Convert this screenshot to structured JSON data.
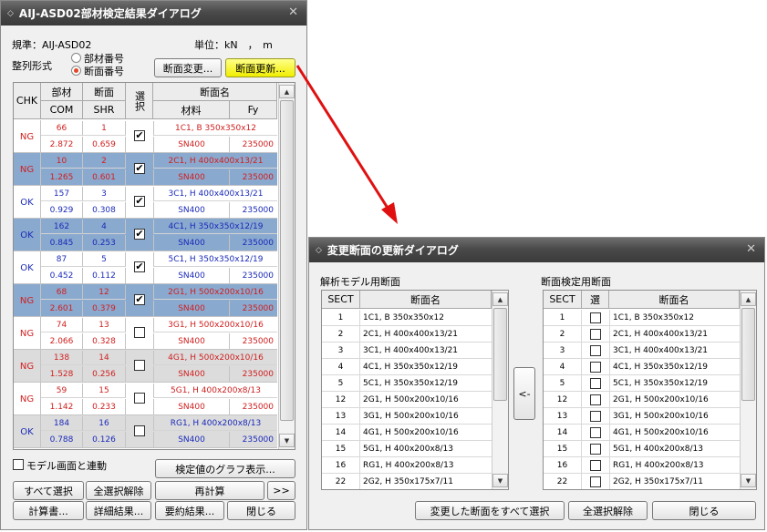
{
  "left_dialog": {
    "title": "AIJ-ASD02部材検定結果ダイアログ",
    "standard": "規準：AIJ-ASD02",
    "unit": "単位：kN　，　m",
    "sort_label": "整列形式",
    "sort_options": [
      "部材番号",
      "断面番号"
    ],
    "btn_section_change": "断面変更...",
    "btn_section_update": "断面更新...",
    "headers": {
      "chk": "CHK",
      "member": "部材",
      "section": "断面",
      "select": "選択",
      "section_name": "断面名",
      "com": "COM",
      "shr": "SHR",
      "material": "材料",
      "fy": "Fy"
    },
    "rows": [
      {
        "chk": "NG",
        "mem": "66",
        "sec": "1",
        "com": "2.872",
        "shr": "0.659",
        "name": "1C1, B 350x350x12",
        "mat": "SN400",
        "fy": "235000",
        "selected": true
      },
      {
        "chk": "NG",
        "mem": "10",
        "sec": "2",
        "com": "1.265",
        "shr": "0.601",
        "name": "2C1, H 400x400x13/21",
        "mat": "SN400",
        "fy": "235000",
        "selected": true
      },
      {
        "chk": "OK",
        "mem": "157",
        "sec": "3",
        "com": "0.929",
        "shr": "0.308",
        "name": "3C1, H 400x400x13/21",
        "mat": "SN400",
        "fy": "235000",
        "selected": true
      },
      {
        "chk": "OK",
        "mem": "162",
        "sec": "4",
        "com": "0.845",
        "shr": "0.253",
        "name": "4C1, H 350x350x12/19",
        "mat": "SN400",
        "fy": "235000",
        "selected": true
      },
      {
        "chk": "OK",
        "mem": "87",
        "sec": "5",
        "com": "0.452",
        "shr": "0.112",
        "name": "5C1, H 350x350x12/19",
        "mat": "SN400",
        "fy": "235000",
        "selected": true
      },
      {
        "chk": "NG",
        "mem": "68",
        "sec": "12",
        "com": "2.601",
        "shr": "0.379",
        "name": "2G1, H 500x200x10/16",
        "mat": "SN400",
        "fy": "235000",
        "selected": true
      },
      {
        "chk": "NG",
        "mem": "74",
        "sec": "13",
        "com": "2.066",
        "shr": "0.328",
        "name": "3G1, H 500x200x10/16",
        "mat": "SN400",
        "fy": "235000",
        "selected": false
      },
      {
        "chk": "NG",
        "mem": "138",
        "sec": "14",
        "com": "1.528",
        "shr": "0.256",
        "name": "4G1, H 500x200x10/16",
        "mat": "SN400",
        "fy": "235000",
        "selected": false
      },
      {
        "chk": "NG",
        "mem": "59",
        "sec": "15",
        "com": "1.142",
        "shr": "0.233",
        "name": "5G1, H 400x200x8/13",
        "mat": "SN400",
        "fy": "235000",
        "selected": false
      },
      {
        "chk": "OK",
        "mem": "184",
        "sec": "16",
        "com": "0.788",
        "shr": "0.126",
        "name": "RG1, H 400x200x8/13",
        "mat": "SN400",
        "fy": "235000",
        "selected": false
      }
    ],
    "model_link": "モデル画面と連動",
    "btn_graph": "検定値のグラフ表示...",
    "btn_select_all": "すべて選択",
    "btn_deselect_all": "全選択解除",
    "btn_recalc": "再計算",
    "btn_more": ">>",
    "btn_calc_doc": "計算書...",
    "btn_detail": "詳細結果...",
    "btn_summary": "要約結果...",
    "btn_close": "閉じる"
  },
  "right_dialog": {
    "title": "変更断面の更新ダイアログ",
    "model_label": "解析モデル用断面",
    "check_label": "断面検定用断面",
    "h_sect": "SECT",
    "h_name": "断面名",
    "h_sel": "選",
    "rows": [
      {
        "sect": "1",
        "name": "1C1, B 350x350x12"
      },
      {
        "sect": "2",
        "name": "2C1, H 400x400x13/21"
      },
      {
        "sect": "3",
        "name": "3C1, H 400x400x13/21"
      },
      {
        "sect": "4",
        "name": "4C1, H 350x350x12/19"
      },
      {
        "sect": "5",
        "name": "5C1, H 350x350x12/19"
      },
      {
        "sect": "12",
        "name": "2G1, H 500x200x10/16"
      },
      {
        "sect": "13",
        "name": "3G1, H 500x200x10/16"
      },
      {
        "sect": "14",
        "name": "4G1, H 500x200x10/16"
      },
      {
        "sect": "15",
        "name": "5G1, H 400x200x8/13"
      },
      {
        "sect": "16",
        "name": "RG1, H 400x200x8/13"
      },
      {
        "sect": "22",
        "name": "2G2, H 350x175x7/11"
      }
    ],
    "btn_arrow": "<-",
    "btn_select_changed": "変更した断面をすべて選択",
    "btn_deselect_all": "全選択解除",
    "btn_close": "閉じる"
  },
  "colors": {
    "ng": "#d02020",
    "ok": "#1a2ab8",
    "row_blue": "#8aa9cf",
    "row_gray": "#dcdcdc",
    "arrow": "#e01010"
  }
}
